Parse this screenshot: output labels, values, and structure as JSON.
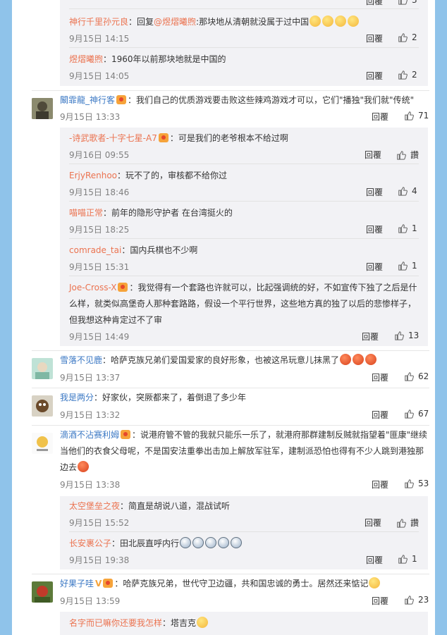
{
  "comments": [
    {
      "subreplies": [
        {
          "user": "神行千里孙元良",
          "text": "：回复",
          "mention": "@煜熠曦煦",
          "text2": ":那块地从清朝就没属于过中国",
          "time": "9月15日 14:15",
          "reply": "回覆",
          "likes": "2"
        },
        {
          "user": "煜熠曦煦",
          "text": "：1960年以前那块地就是中国的",
          "time": "9月15日 14:05",
          "reply": "回覆",
          "likes": "2"
        }
      ]
    },
    {
      "user": "闞霏龍_神行客",
      "text": "：我们自己的优质游戏要击败这些辣鸡游戏才可以，它们\"播独\"我们就\"传统\"",
      "time": "9月15日 13:33",
      "reply": "回覆",
      "likes": "71",
      "subreplies": [
        {
          "user": "-诗武歌者-十字七星-A7",
          "text": "：可是我们的老爷根本不给过啊",
          "time": "9月16日 09:55",
          "reply": "回覆",
          "likes": "讚"
        },
        {
          "user": "ErjyRenhoo",
          "text": "：玩不了的，审核都不给你过",
          "time": "9月15日 18:46",
          "reply": "回覆",
          "likes": "4"
        },
        {
          "user": "喵喵正常",
          "text": "：前年的隐形守护者 在台湾挺火的",
          "time": "9月15日 18:25",
          "reply": "回覆",
          "likes": "1"
        },
        {
          "user": "comrade_tai",
          "text": "：国内兵棋也不少啊",
          "time": "9月15日 15:31",
          "reply": "回覆",
          "likes": "1"
        },
        {
          "user": "Joe-Cross-X",
          "text": "：我觉得有一个套路也许就可以，比起强调统的好，不如宣传下独了之后是什么样，就类似高堡奇人那种套路路，假设一个平行世界，这些地方真的独了以后的悲惨样子，但我想这种肯定过不了审",
          "time": "9月15日 14:49",
          "reply": "回覆",
          "likes": "13"
        }
      ]
    },
    {
      "user": "雪落不见鹿",
      "text": "：哈萨克族兄弟们爱国爱家的良好形象，也被这吊玩意儿抹黑了",
      "time": "9月15日 13:37",
      "reply": "回覆",
      "likes": "62"
    },
    {
      "user": "我是两分",
      "text": "：好家伙，突厥都来了，着倒退了多少年",
      "time": "9月15日 13:32",
      "reply": "回覆",
      "likes": "67"
    },
    {
      "user": "滴酒不沾赛利姆",
      "text": "：说港府管不管的我就只能乐一乐了，就港府那群建制反贼就指望着\"匪康\"继续当他们的衣食父母呢，不是国安法重拳出击加上解放军驻军，建制派恐怕也得有不少人跳到港独那边去",
      "time": "9月15日 13:38",
      "reply": "回覆",
      "likes": "53",
      "subreplies": [
        {
          "user": "太空堡垒之夜",
          "text": "：简直是胡说八道，混战试听",
          "time": "9月15日 15:52",
          "reply": "回覆",
          "likes": "讚"
        },
        {
          "user": "长安裹公子",
          "text": "：田北辰直呼内行",
          "time": "9月15日 19:38",
          "reply": "回覆",
          "likes": "1"
        }
      ]
    },
    {
      "user": "好果子哇",
      "text": "：哈萨克族兄弟，世代守卫边疆，共和国忠诚的勇士。居然还来惦记",
      "time": "9月15日 13:59",
      "reply": "回覆",
      "likes": "23",
      "subreplies": [
        {
          "user": "名字而已嘛你还要我怎样",
          "text": "：塔吉克",
          "time": "",
          "reply": "",
          "likes": ""
        }
      ]
    }
  ],
  "top_partial": {
    "reply": "回覆",
    "likes": "3"
  },
  "colors": {
    "background": "#8fc3ea",
    "username": "#eb7350",
    "subreply_bg": "#f2f2f5"
  }
}
